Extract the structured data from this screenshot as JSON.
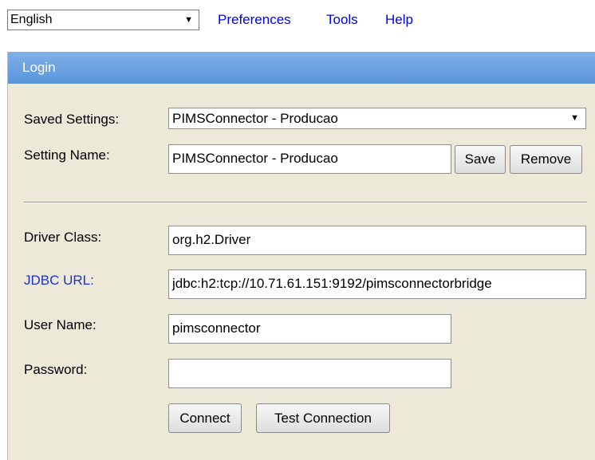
{
  "top_bar": {
    "language": "English",
    "menu": [
      "Preferences",
      "Tools",
      "Help"
    ]
  },
  "panel": {
    "title": "Login",
    "saved_settings": {
      "label": "Saved Settings:",
      "value": "PIMSConnector - Producao"
    },
    "setting_name": {
      "label": "Setting Name:",
      "value": "PIMSConnector - Producao",
      "save_label": "Save",
      "remove_label": "Remove"
    },
    "driver_class": {
      "label": "Driver Class:",
      "value": "org.h2.Driver"
    },
    "jdbc_url": {
      "label": "JDBC URL:",
      "value": "jdbc:h2:tcp://10.71.61.151:9192/pimsconnectorbridge"
    },
    "user_name": {
      "label": "User Name:",
      "value": "pimsconnector"
    },
    "password": {
      "label": "Password:",
      "value": ""
    },
    "buttons": {
      "connect": "Connect",
      "test_connection": "Test Connection"
    }
  },
  "colors": {
    "header_gradient_top": "#7fb0e8",
    "header_gradient_bottom": "#5b95dc",
    "panel_background": "#ece9d8",
    "link": "#0000ee",
    "jdbc_label": "#1a33cc"
  },
  "icons": {
    "dropdown": "chevron-down-icon"
  }
}
